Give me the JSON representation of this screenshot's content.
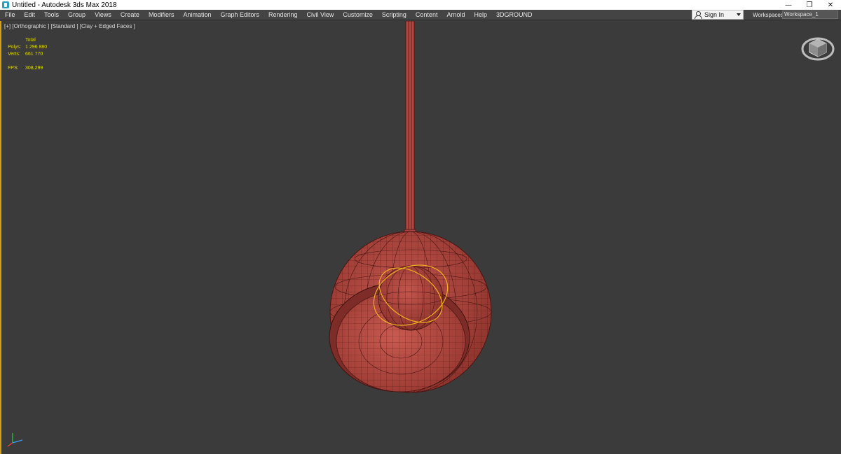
{
  "window": {
    "title": "Untitled - Autodesk 3ds Max 2018",
    "minimize_glyph": "—",
    "restore_glyph": "❐",
    "close_glyph": "✕"
  },
  "menu": {
    "items": [
      "File",
      "Edit",
      "Tools",
      "Group",
      "Views",
      "Create",
      "Modifiers",
      "Animation",
      "Graph Editors",
      "Rendering",
      "Civil View",
      "Customize",
      "Scripting",
      "Content",
      "Arnold",
      "Help",
      "3DGROUND"
    ]
  },
  "account": {
    "sign_in_label": "Sign In"
  },
  "workspaces": {
    "label": "Workspaces:",
    "selected": "Workspace_1"
  },
  "viewport": {
    "label": "[+] [Orthographic ] [Standard ] [Clay + Edged Faces ]",
    "stats": {
      "header": "Total",
      "polys_label": "Polys:",
      "polys_value": "1 296 880",
      "verts_label": "Verts:",
      "verts_value": "661 770",
      "fps_label": "FPS:",
      "fps_value": "308,299"
    }
  },
  "colors": {
    "model_fill": "#b0463f",
    "model_wire": "#4a1512",
    "selection": "#f0b020",
    "stats_text": "#e0d600",
    "viewport_bg": "#3b3b3b",
    "active_border": "#d4a017"
  },
  "icons": {
    "app": "3ds-max-icon",
    "user": "user-icon",
    "viewcube": "viewcube-icon",
    "axis": "axis-tripod-icon"
  }
}
